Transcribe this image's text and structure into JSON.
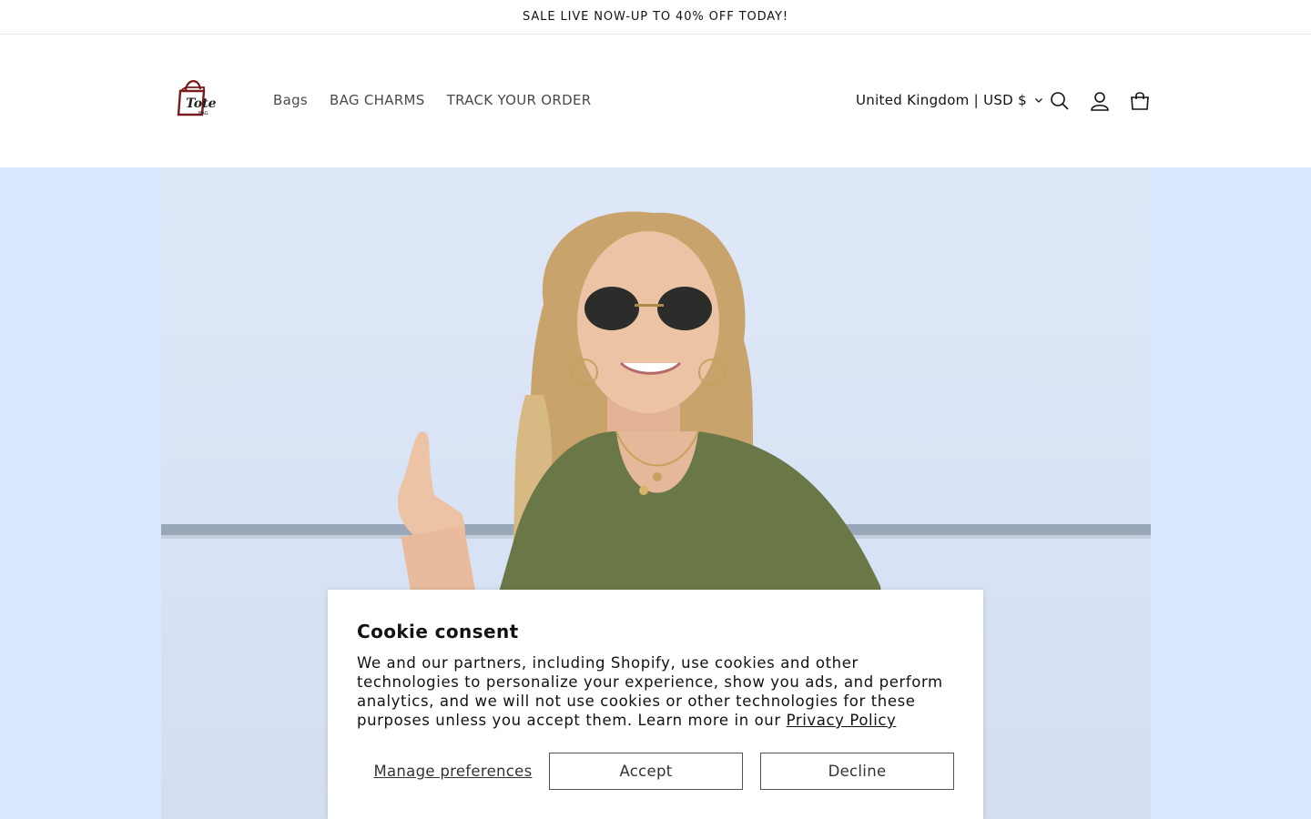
{
  "announcement": {
    "text": "SALE LIVE NOW-UP TO 40% OFF TODAY!"
  },
  "header": {
    "logo": {
      "brand_text": "Tote",
      "sub_text": "BAG",
      "icon": "tote-bag-logo"
    },
    "nav": [
      {
        "label": "Bags"
      },
      {
        "label": "BAG CHARMS"
      },
      {
        "label": "TRACK YOUR ORDER"
      }
    ],
    "country_selector": {
      "label": "United Kingdom | USD $",
      "icon": "chevron-down-icon"
    },
    "icons": [
      "search-icon",
      "account-icon",
      "cart-icon"
    ]
  },
  "hero": {
    "image": "woman-in-sunglasses-olive-tshirt",
    "background_color": "#d9e6fb"
  },
  "cookie_banner": {
    "title": "Cookie consent",
    "body": "We and our partners, including Shopify, use cookies and other technologies to personalize your experience, show you ads, and perform analytics, and we will not use cookies or other technologies for these purposes unless you accept them. Learn more in our ",
    "privacy_link": "Privacy Policy",
    "manage_label": "Manage preferences",
    "accept_label": "Accept",
    "decline_label": "Decline"
  }
}
